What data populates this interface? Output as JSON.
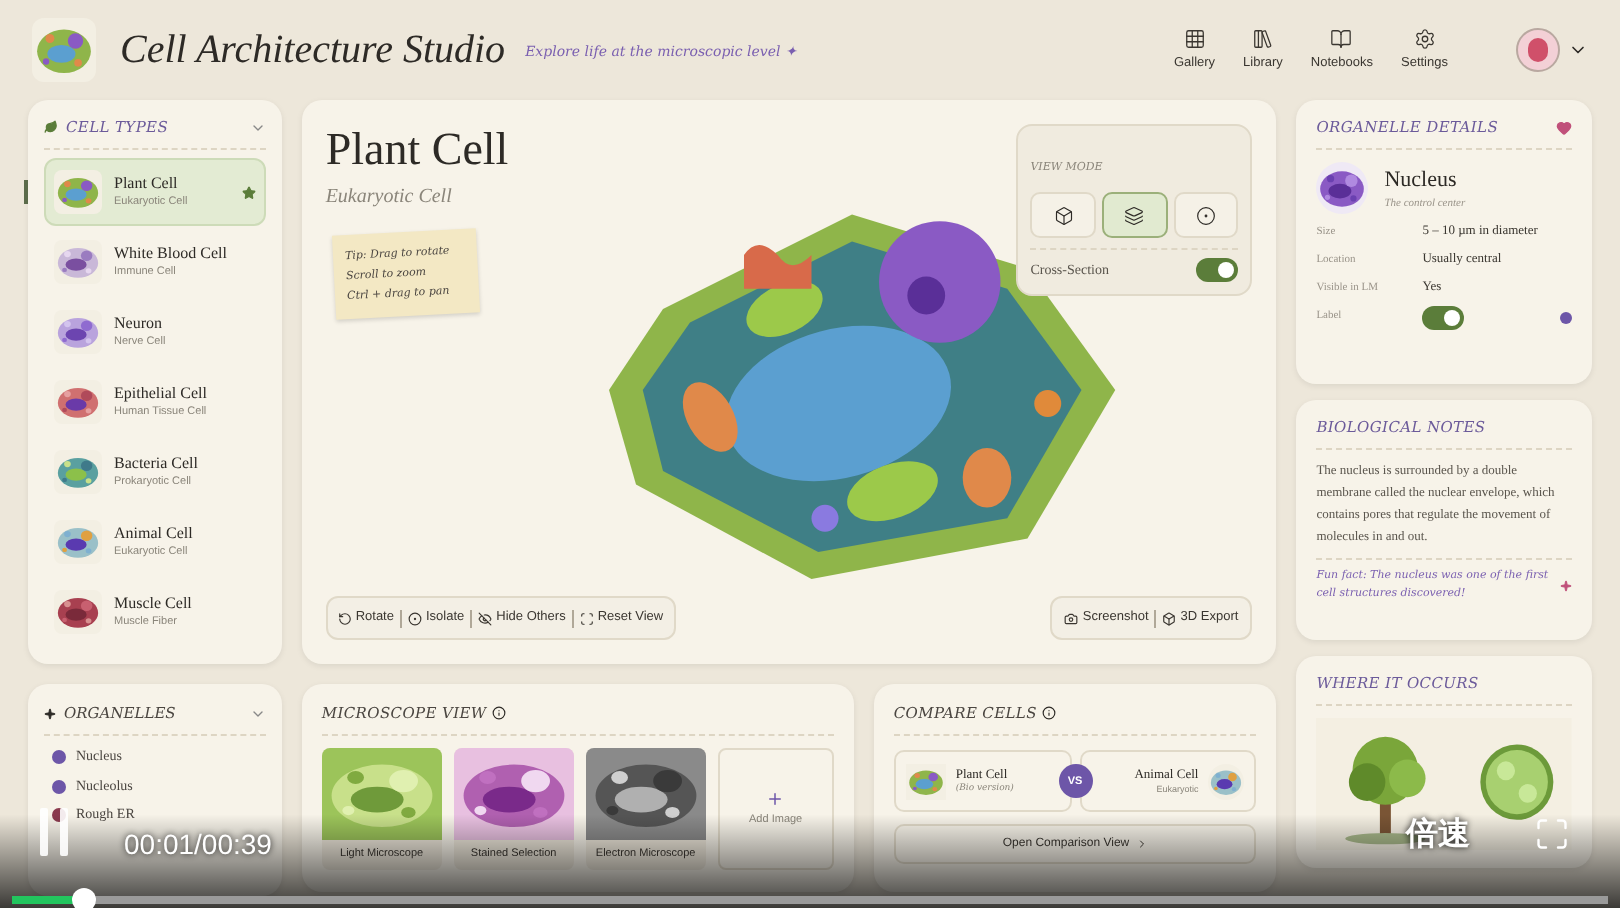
{
  "header": {
    "title": "Cell Architecture Studio",
    "tagline": "Explore life at the microscopic level ✦",
    "nav": [
      "Gallery",
      "Library",
      "Notebooks",
      "Settings"
    ]
  },
  "cell_types": {
    "title": "CELL TYPES",
    "items": [
      {
        "name": "Plant Cell",
        "subtitle": "Eukaryotic Cell",
        "selected": true,
        "favorite": true
      },
      {
        "name": "White Blood Cell",
        "subtitle": "Immune Cell",
        "selected": false,
        "favorite": false
      },
      {
        "name": "Neuron",
        "subtitle": "Nerve Cell",
        "selected": false,
        "favorite": false
      },
      {
        "name": "Epithelial Cell",
        "subtitle": "Human Tissue Cell",
        "selected": false,
        "favorite": false
      },
      {
        "name": "Bacteria Cell",
        "subtitle": "Prokaryotic Cell",
        "selected": false,
        "favorite": false
      },
      {
        "name": "Animal Cell",
        "subtitle": "Eukaryotic Cell",
        "selected": false,
        "favorite": false
      },
      {
        "name": "Muscle Cell",
        "subtitle": "Muscle Fiber",
        "selected": false,
        "favorite": false
      }
    ]
  },
  "viewer": {
    "title": "Plant Cell",
    "subtitle": "Eukaryotic Cell",
    "tips": [
      "Tip: Drag to rotate",
      "Scroll to zoom",
      "Ctrl + drag to pan"
    ],
    "view_mode": {
      "title": "VIEW MODE",
      "modes": [
        {
          "selected": false
        },
        {
          "selected": true
        },
        {
          "selected": false
        }
      ],
      "cross_section": {
        "label": "Cross-Section",
        "on": true
      }
    },
    "tools": [
      "Rotate",
      "Isolate",
      "Hide Others",
      "Reset View"
    ],
    "export_tools": [
      "Screenshot",
      "3D Export"
    ]
  },
  "organelle_details": {
    "title": "ORGANELLE DETAILS",
    "name": "Nucleus",
    "subtitle": "The control center",
    "properties": [
      {
        "label": "Size",
        "value": "5 – 10 µm in diameter"
      },
      {
        "label": "Location",
        "value": "Usually central"
      },
      {
        "label": "Visible in LM",
        "value": "Yes"
      }
    ],
    "label_toggle": {
      "label": "Label",
      "on": true,
      "color": "#6d56a8"
    }
  },
  "biological_notes": {
    "title": "BIOLOGICAL NOTES",
    "text": "The nucleus is surrounded by a double membrane called the nuclear envelope, which contains pores that regulate the movement of molecules in and out.",
    "fun_fact": "Fun fact: The nucleus was one of the first cell structures discovered!"
  },
  "where_it_occurs": {
    "title": "WHERE IT OCCURS"
  },
  "organelles": {
    "title": "ORGANELLES",
    "items": [
      {
        "name": "Nucleus",
        "color": "#6d56a8"
      },
      {
        "name": "Nucleolus",
        "color": "#6d56a8"
      },
      {
        "name": "Rough ER",
        "color": "#8a3a4e"
      }
    ]
  },
  "microscope_view": {
    "title": "MICROSCOPE VIEW",
    "images": [
      "Light Microscope",
      "Stained Selection",
      "Electron Microscope"
    ],
    "add_label": "Add Image"
  },
  "compare_cells": {
    "title": "COMPARE CELLS",
    "left": {
      "name": "Plant Cell",
      "subtitle": "(Bio version)"
    },
    "vs": "VS",
    "right": {
      "name": "Animal Cell",
      "subtitle": "Eukaryotic"
    },
    "button": "Open Comparison View"
  },
  "player": {
    "playing": true,
    "time": "00:01/00:39",
    "speed": "倍速",
    "level": 0.045
  }
}
